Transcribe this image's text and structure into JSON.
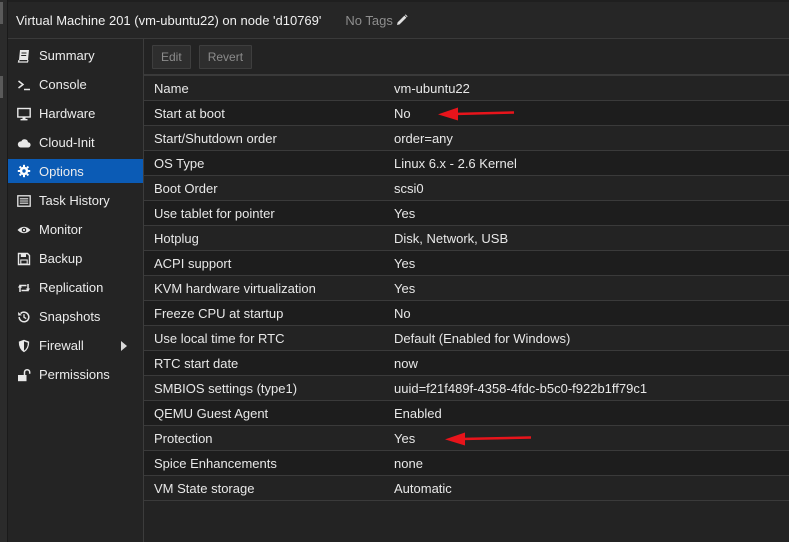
{
  "header": {
    "title": "Virtual Machine 201 (vm-ubuntu22) on node 'd10769'",
    "tags_label": "No Tags"
  },
  "sidebar": {
    "items": [
      {
        "label": "Summary",
        "icon": "book-icon"
      },
      {
        "label": "Console",
        "icon": "terminal-icon"
      },
      {
        "label": "Hardware",
        "icon": "monitor-icon"
      },
      {
        "label": "Cloud-Init",
        "icon": "cloud-icon"
      },
      {
        "label": "Options",
        "icon": "gear-icon",
        "active": true
      },
      {
        "label": "Task History",
        "icon": "list-icon"
      },
      {
        "label": "Monitor",
        "icon": "eye-icon"
      },
      {
        "label": "Backup",
        "icon": "floppy-icon"
      },
      {
        "label": "Replication",
        "icon": "retweet-icon"
      },
      {
        "label": "Snapshots",
        "icon": "history-icon"
      },
      {
        "label": "Firewall",
        "icon": "shield-icon",
        "has_submenu": true
      },
      {
        "label": "Permissions",
        "icon": "unlock-icon"
      }
    ]
  },
  "toolbar": {
    "edit_label": "Edit",
    "revert_label": "Revert"
  },
  "options": {
    "rows": [
      {
        "name": "Name",
        "value": "vm-ubuntu22"
      },
      {
        "name": "Start at boot",
        "value": "No"
      },
      {
        "name": "Start/Shutdown order",
        "value": "order=any"
      },
      {
        "name": "OS Type",
        "value": "Linux 6.x - 2.6 Kernel"
      },
      {
        "name": "Boot Order",
        "value": "scsi0"
      },
      {
        "name": "Use tablet for pointer",
        "value": "Yes"
      },
      {
        "name": "Hotplug",
        "value": "Disk, Network, USB"
      },
      {
        "name": "ACPI support",
        "value": "Yes"
      },
      {
        "name": "KVM hardware virtualization",
        "value": "Yes"
      },
      {
        "name": "Freeze CPU at startup",
        "value": "No"
      },
      {
        "name": "Use local time for RTC",
        "value": "Default (Enabled for Windows)"
      },
      {
        "name": "RTC start date",
        "value": "now"
      },
      {
        "name": "SMBIOS settings (type1)",
        "value": "uuid=f21f489f-4358-4fdc-b5c0-f922b1ff79c1"
      },
      {
        "name": "QEMU Guest Agent",
        "value": "Enabled"
      },
      {
        "name": "Protection",
        "value": "Yes"
      },
      {
        "name": "Spice Enhancements",
        "value": "none"
      },
      {
        "name": "VM State storage",
        "value": "Automatic"
      }
    ]
  },
  "colors": {
    "accent": "#0b5bb5",
    "annotation_arrow": "#e8141b"
  }
}
